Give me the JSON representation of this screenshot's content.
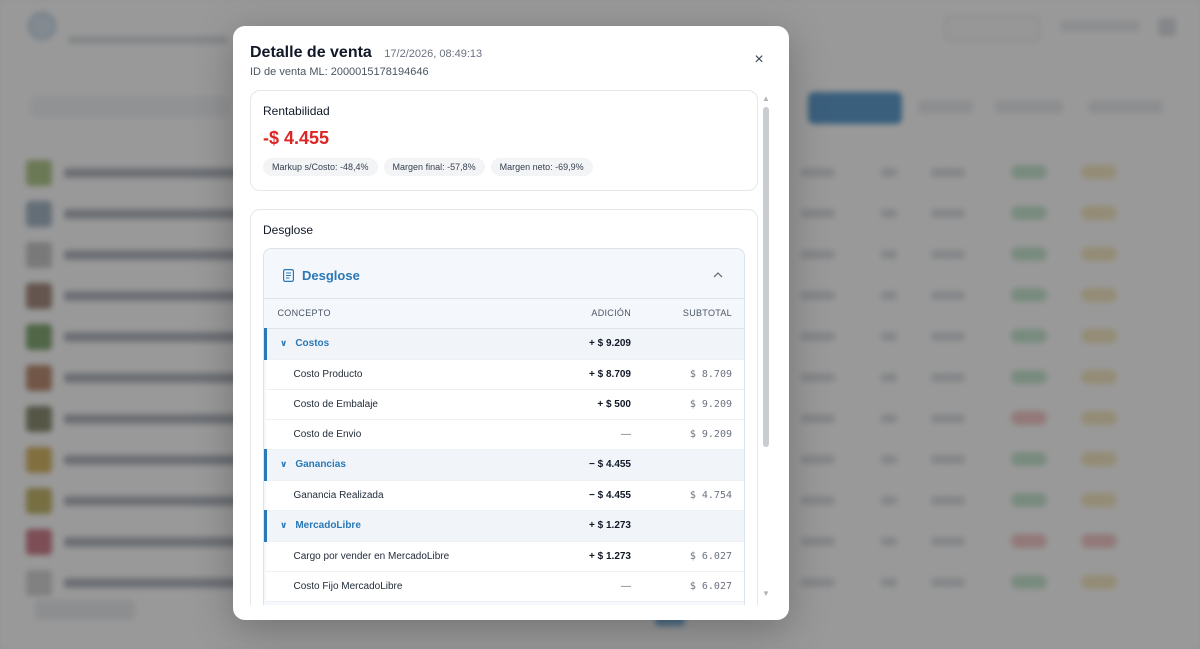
{
  "modal": {
    "title": "Detalle de venta",
    "date": "17/2/2026, 08:49:13",
    "sale_id": "ID de venta ML: 2000015178194646",
    "close_icon": "close-icon"
  },
  "rentabilidad": {
    "label": "Rentabilidad",
    "value": "-$ 4.455",
    "value_color": "#dc2626",
    "chips": [
      "Markup s/Costo: -48,4%",
      "Margen final: -57,8%",
      "Margen neto: -69,9%"
    ]
  },
  "desglose": {
    "card_label": "Desglose",
    "section_title": "Desglose",
    "section_icon": "document-icon",
    "accent_color": "#2a78b6",
    "columns": {
      "concepto": "CONCEPTO",
      "adicion": "ADICIÓN",
      "subtotal": "SUBTOTAL"
    },
    "groups": [
      {
        "name": "Costos",
        "adicion": "+ $ 9.209",
        "items": [
          {
            "concepto": "Costo Producto",
            "adicion": "+ $ 8.709",
            "subtotal": "$ 8.709"
          },
          {
            "concepto": "Costo de Embalaje",
            "adicion": "+ $ 500",
            "subtotal": "$ 9.209"
          },
          {
            "concepto": "Costo de Envio",
            "adicion": "—",
            "subtotal": "$ 9.209"
          }
        ]
      },
      {
        "name": "Ganancias",
        "adicion": "− $ 4.455",
        "items": [
          {
            "concepto": "Ganancia Realizada",
            "adicion": "− $ 4.455",
            "subtotal": "$ 4.754"
          }
        ]
      },
      {
        "name": "MercadoLibre",
        "adicion": "+ $ 1.273",
        "items": [
          {
            "concepto": "Cargo por vender en MercadoLibre",
            "adicion": "+ $ 1.273",
            "subtotal": "$ 6.027"
          },
          {
            "concepto": "Costo Fijo MercadoLibre",
            "adicion": "—",
            "subtotal": "$ 6.027"
          }
        ]
      }
    ]
  }
}
